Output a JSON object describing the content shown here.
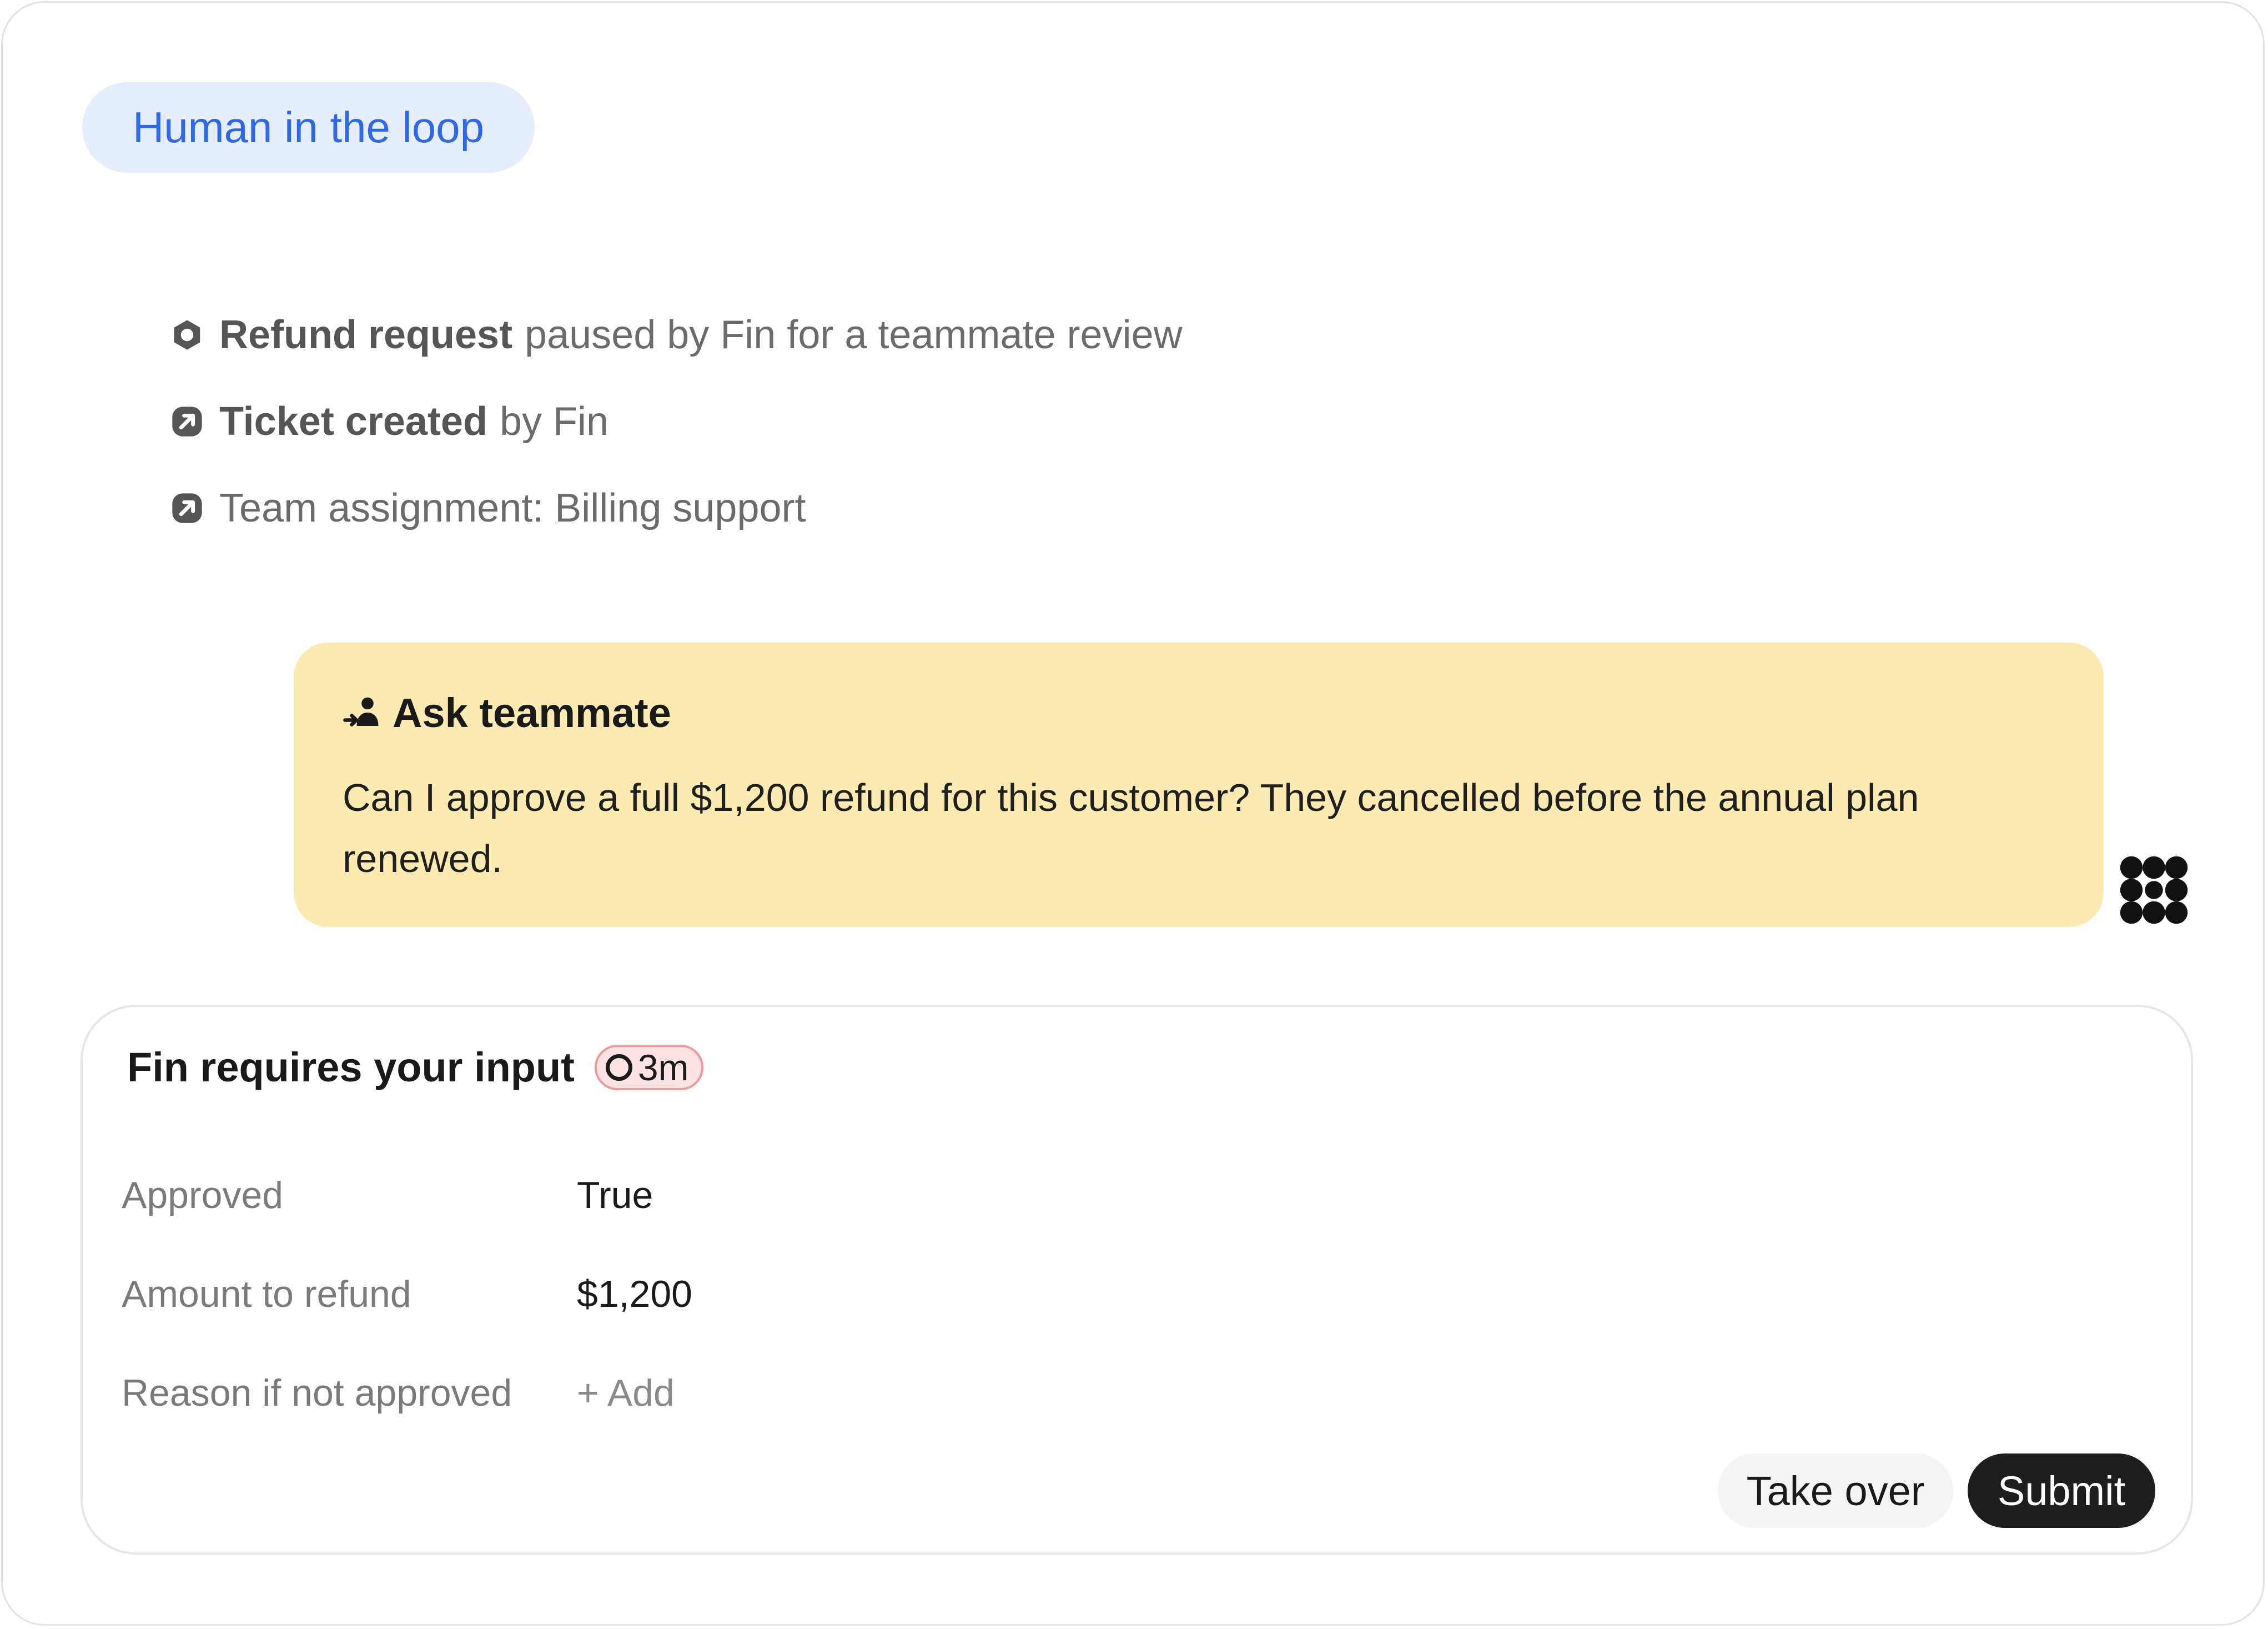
{
  "badge": {
    "label": "Human in the loop"
  },
  "events": [
    {
      "icon": "hexagon-icon",
      "bold": "Refund request",
      "text": "paused by Fin for a teammate review"
    },
    {
      "icon": "arrow-up-right-icon",
      "bold": "Ticket created",
      "text": "by Fin"
    },
    {
      "icon": "arrow-up-right-icon",
      "bold": "",
      "text": "Team assignment: Billing support"
    }
  ],
  "ask": {
    "title": "Ask teammate",
    "message": "Can I approve a full $1,200 refund for this customer? They cancelled before the annual plan renewed."
  },
  "input_card": {
    "title": "Fin requires your input",
    "timer": "3m",
    "fields": [
      {
        "label": "Approved",
        "value": "True"
      },
      {
        "label": "Amount to refund",
        "value": "$1,200"
      },
      {
        "label": "Reason if not approved",
        "value": "+ Add"
      }
    ],
    "take_over_label": "Take over",
    "submit_label": "Submit"
  },
  "colors": {
    "badge_bg": "#e6edfd",
    "badge_text": "#2d68e8",
    "ask_bg": "#fbeab1",
    "timer_bg": "#fde3e3",
    "timer_border": "#ef9a9a",
    "submit_bg": "#1e1e1e"
  }
}
